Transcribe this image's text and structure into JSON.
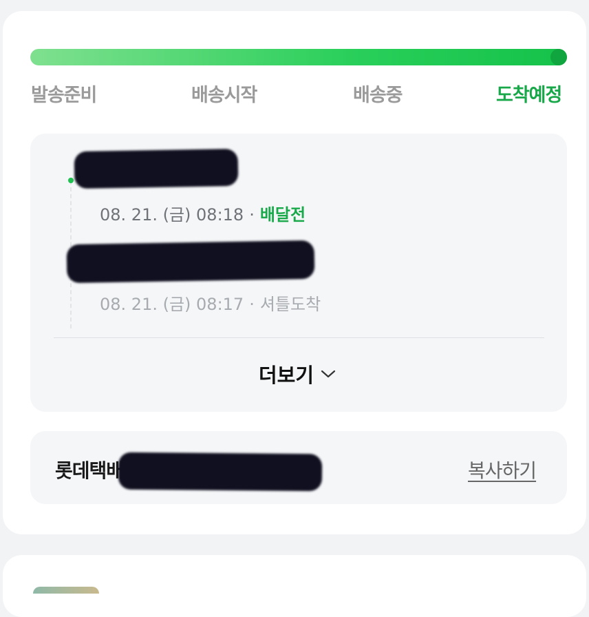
{
  "progress": {
    "value": 1.0
  },
  "steps": [
    {
      "label": "발송준비",
      "active": false
    },
    {
      "label": "배송시작",
      "active": false
    },
    {
      "label": "배송중",
      "active": false
    },
    {
      "label": "도착예정",
      "active": true
    }
  ],
  "timeline": {
    "events": [
      {
        "time": "08. 21. (금) 08:18",
        "status": "배달전"
      },
      {
        "time": "08. 21. (금) 08:17",
        "status": "셔틀도착"
      }
    ],
    "separator": "·",
    "more_label": "더보기"
  },
  "carrier": {
    "name": "롯데택배",
    "copy_label": "복사하기"
  },
  "colors": {
    "accent_green": "#18a84a",
    "inactive_step": "#9a9a9a"
  },
  "icons": {
    "more": "chevron-down-icon"
  }
}
